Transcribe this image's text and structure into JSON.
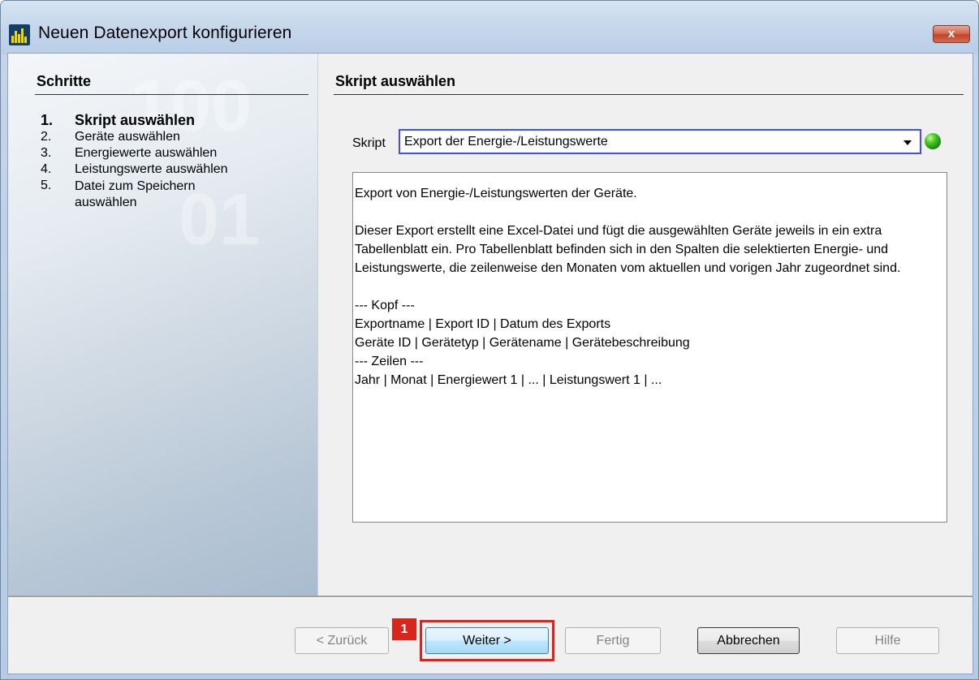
{
  "window": {
    "title": "Neuen Datenexport konfigurieren",
    "close_glyph": "x",
    "app_icon": "app-logo-icon"
  },
  "steps": {
    "header": "Schritte",
    "items": [
      {
        "num": "1.",
        "label": "Skript auswählen",
        "active": true
      },
      {
        "num": "2.",
        "label": "Geräte auswählen",
        "active": false
      },
      {
        "num": "3.",
        "label": "Energiewerte auswählen",
        "active": false
      },
      {
        "num": "4.",
        "label": "Leistungswerte auswählen",
        "active": false
      },
      {
        "num": "5.",
        "label": "Datei zum Speichern auswählen",
        "active": false
      }
    ]
  },
  "page": {
    "header": "Skript auswählen",
    "script_label": "Skript",
    "script_selected": "Export der Energie-/Leistungswerte",
    "status_color": "#2fb816",
    "description": [
      "Export von Energie-/Leistungswerten der Geräte.",
      "",
      "Dieser Export erstellt eine Excel-Datei und fügt die ausgewählten Geräte jeweils in ein extra Tabellenblatt ein. Pro Tabellenblatt befinden sich in den Spalten die selektierten Energie- und Leistungswerte, die zeilenweise den Monaten vom aktuellen und vorigen Jahr zugeordnet sind.",
      "",
      "--- Kopf ---",
      "Exportname | Export ID | Datum des Exports",
      "Geräte ID | Gerätetyp | Gerätename | Gerätebeschreibung",
      "--- Zeilen ---",
      "Jahr | Monat | Energiewert 1 | ... | Leistungswert 1 | ..."
    ]
  },
  "buttons": {
    "back": "< Zurück",
    "next": "Weiter >",
    "finish": "Fertig",
    "cancel": "Abbrechen",
    "help": "Hilfe"
  },
  "callout": {
    "number": "1",
    "color": "#e2221b"
  }
}
